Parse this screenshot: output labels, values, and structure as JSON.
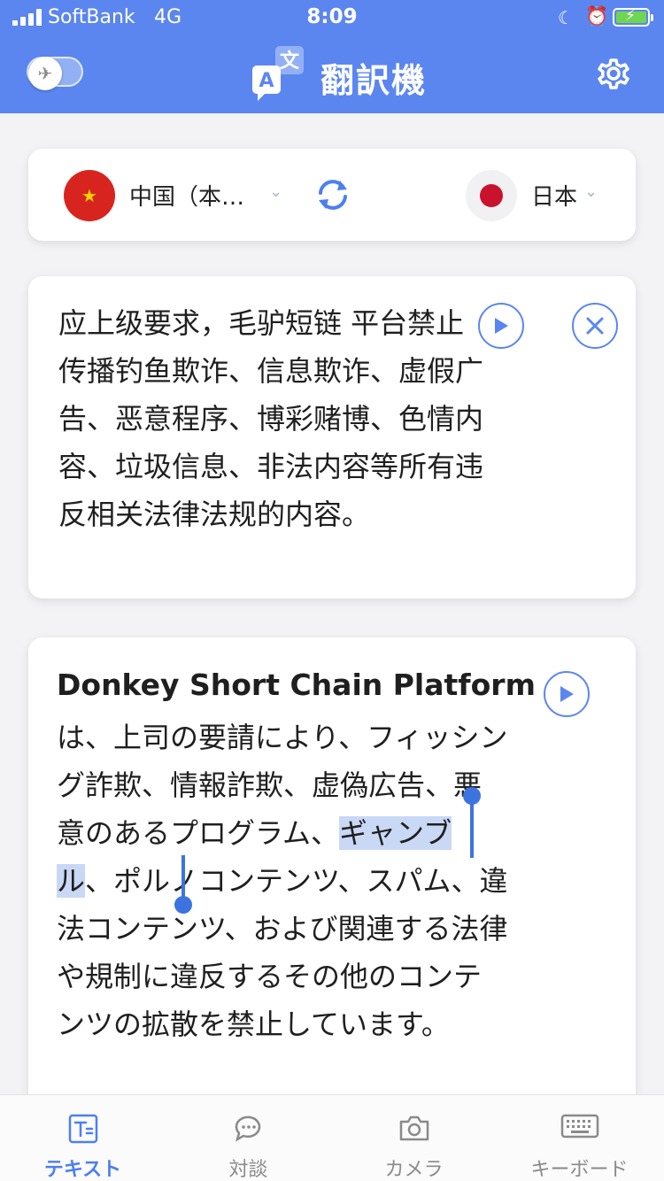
{
  "status_bar": {
    "carrier": "SoftBank",
    "network": "4G",
    "time": "8:09"
  },
  "header": {
    "title": "翻訳機",
    "logo_letters": {
      "front": "A",
      "back": "文"
    }
  },
  "languages": {
    "source": "中国（本…",
    "target": "日本"
  },
  "source_text": "应上级要求，毛驴短链 平台禁止传播钓鱼欺诈、信息欺诈、虚假广告、恶意程序、博彩赌博、色情内容、垃圾信息、非法内容等所有违反相关法律法规的内容。",
  "translation": {
    "english": "Donkey Short Chain Platform",
    "japanese_before": "は、上司の要請により、フィッシング詐欺、情報詐欺、虚偽広告、悪意のあるプログラム、",
    "japanese_selected": "ギャンブル",
    "japanese_after": "、ポルノコンテンツ、スパム、違法コンテンツ、および関連する法律や規制に違反するその他のコンテンツの拡散を禁止しています。"
  },
  "tabs": [
    {
      "label": "テキスト",
      "icon": "text-icon",
      "active": true
    },
    {
      "label": "対談",
      "icon": "conversation-icon",
      "active": false
    },
    {
      "label": "カメラ",
      "icon": "camera-icon",
      "active": false
    },
    {
      "label": "キーボード",
      "icon": "keyboard-icon",
      "active": false
    }
  ],
  "colors": {
    "brand": "#5b86f0",
    "selection": "#c9d8f5",
    "handle": "#3d73e0",
    "active_tab": "#4c7ff0"
  }
}
